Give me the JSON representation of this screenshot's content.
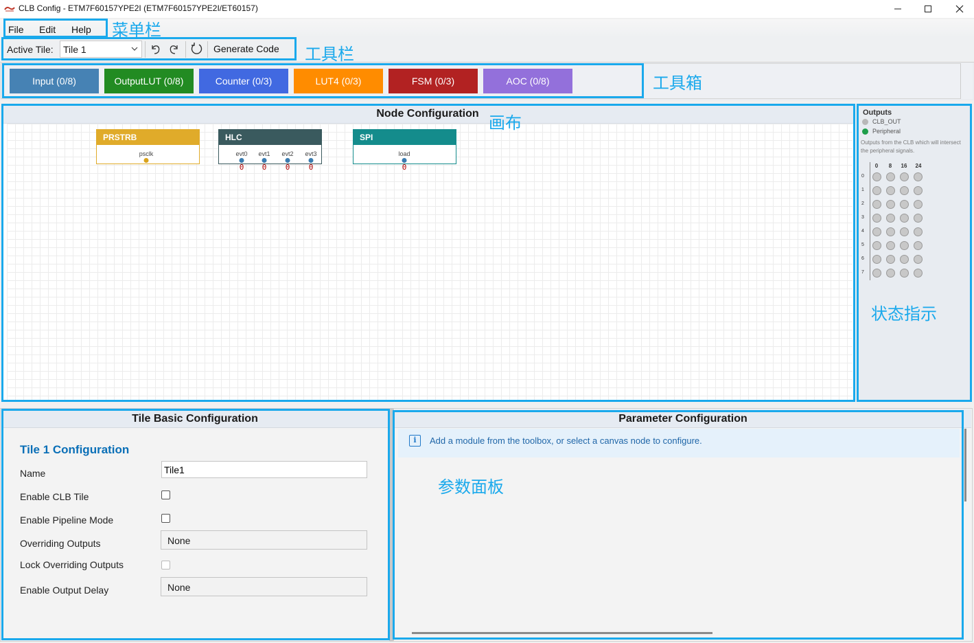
{
  "window": {
    "title": "CLB Config - ETM7F60157YPE2I (ETM7F60157YPE2I/ET60157)",
    "controls": {
      "minimize": "—",
      "maximize": "☐",
      "close": "✕"
    }
  },
  "menu": {
    "items": [
      "File",
      "Edit",
      "Help"
    ]
  },
  "toolbar": {
    "active_tile_label": "Active Tile:",
    "active_tile_value": "Tile 1",
    "generate_code_label": "Generate Code",
    "icons": [
      "undo-icon",
      "redo-icon",
      "refresh-icon"
    ]
  },
  "toolbox": {
    "buttons": [
      {
        "label": "Input (0/8)",
        "color": "#4682b4"
      },
      {
        "label": "OutputLUT (0/8)",
        "color": "#228b22"
      },
      {
        "label": "Counter (0/3)",
        "color": "#4169e1"
      },
      {
        "label": "LUT4 (0/3)",
        "color": "#ff8c00"
      },
      {
        "label": "FSM (0/3)",
        "color": "#b22222"
      },
      {
        "label": "AOC (0/8)",
        "color": "#9370db"
      }
    ]
  },
  "canvas": {
    "title": "Node Configuration",
    "nodes": [
      {
        "title": "PRSTRB",
        "color": "#e0ab2a",
        "ports": [
          {
            "label": "psclk",
            "value": ""
          }
        ]
      },
      {
        "title": "HLC",
        "color": "#3a5a5e",
        "ports": [
          {
            "label": "evt0",
            "value": "0"
          },
          {
            "label": "evt1",
            "value": "0"
          },
          {
            "label": "evt2",
            "value": "0"
          },
          {
            "label": "evt3",
            "value": "0"
          }
        ]
      },
      {
        "title": "SPI",
        "color": "#148c8c",
        "ports": [
          {
            "label": "load",
            "value": "0"
          }
        ]
      }
    ]
  },
  "status_panel": {
    "title": "Outputs",
    "legend": [
      {
        "label": "CLB_OUT",
        "color": "#b8b8b8"
      },
      {
        "label": "Peripheral",
        "color": "#1e9e4a"
      }
    ],
    "description": "Outputs from the CLB which will intersect the peripheral signals.",
    "column_labels": [
      "0",
      "8",
      "16",
      "24"
    ],
    "row_labels": [
      "0",
      "1",
      "2",
      "3",
      "4",
      "5",
      "6",
      "7"
    ]
  },
  "tile_basic": {
    "title": "Tile Basic Configuration",
    "section_title": "Tile 1 Configuration",
    "name_label": "Name",
    "name_value": "Tile1",
    "enable_clb_label": "Enable CLB Tile",
    "enable_clb_checked": false,
    "pipeline_label": "Enable Pipeline Mode",
    "pipeline_checked": false,
    "overriding_outputs_label": "Overriding Outputs",
    "overriding_outputs_value": "None",
    "lock_overriding_label": "Lock Overriding Outputs",
    "lock_overriding_checked": false,
    "output_delay_label": "Enable Output Delay",
    "output_delay_value": "None"
  },
  "parameter_config": {
    "title": "Parameter Configuration",
    "info_icon": "i",
    "info_text": "Add a module from the toolbox, or select a canvas node to configure."
  },
  "annotations": {
    "menubar": "菜单栏",
    "toolbar": "工具栏",
    "toolbox": "工具箱",
    "canvas": "画布",
    "status": "状态指示",
    "params": "参数面板",
    "color": "#1aa9ec"
  }
}
